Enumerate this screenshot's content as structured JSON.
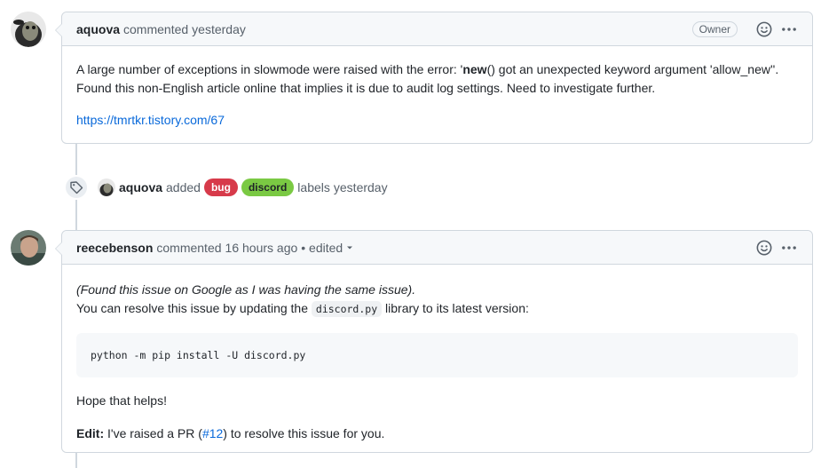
{
  "comment1": {
    "author": "aquova",
    "action": "commented",
    "time": "yesterday",
    "badge": "Owner",
    "body_line1_prefix": "A large number of exceptions in slowmode were raised with the error: '",
    "body_line1_bold": "new",
    "body_line1_suffix": "() got an unexpected keyword argument 'allow_new''.",
    "body_line2": "Found this non-English article online that implies it is due to audit log settings. Need to investigate further.",
    "link": "https://tmrtkr.tistory.com/67"
  },
  "event": {
    "actor": "aquova",
    "action": "added",
    "labels": [
      {
        "name": "bug",
        "bg": "#d73a4a",
        "fg": "#ffffff"
      },
      {
        "name": "discord",
        "bg": "#7ac943",
        "fg": "#1f2328"
      }
    ],
    "suffix": "labels",
    "time": "yesterday"
  },
  "comment2": {
    "author": "reecebenson",
    "action": "commented",
    "time": "16 hours ago",
    "edited": "• edited",
    "p1": "(Found this issue on Google as I was having the same issue).",
    "p2_prefix": "You can resolve this issue by updating the",
    "p2_code": "discord.py",
    "p2_suffix": "library to its latest version:",
    "code_block": "python -m pip install -U discord.py",
    "p3": "Hope that helps!",
    "p4_bold": "Edit:",
    "p4_prefix": "I've raised a PR (",
    "p4_link": "#12",
    "p4_suffix": ") to resolve this issue for you."
  },
  "icons": {
    "smiley": "smiley-icon",
    "kebab": "kebab-horizontal-icon",
    "tag": "tag-icon",
    "caret": "triangle-down-icon"
  },
  "colors": {
    "link": "#0969da",
    "border": "#d0d7de",
    "header_bg": "#f6f8fa"
  }
}
